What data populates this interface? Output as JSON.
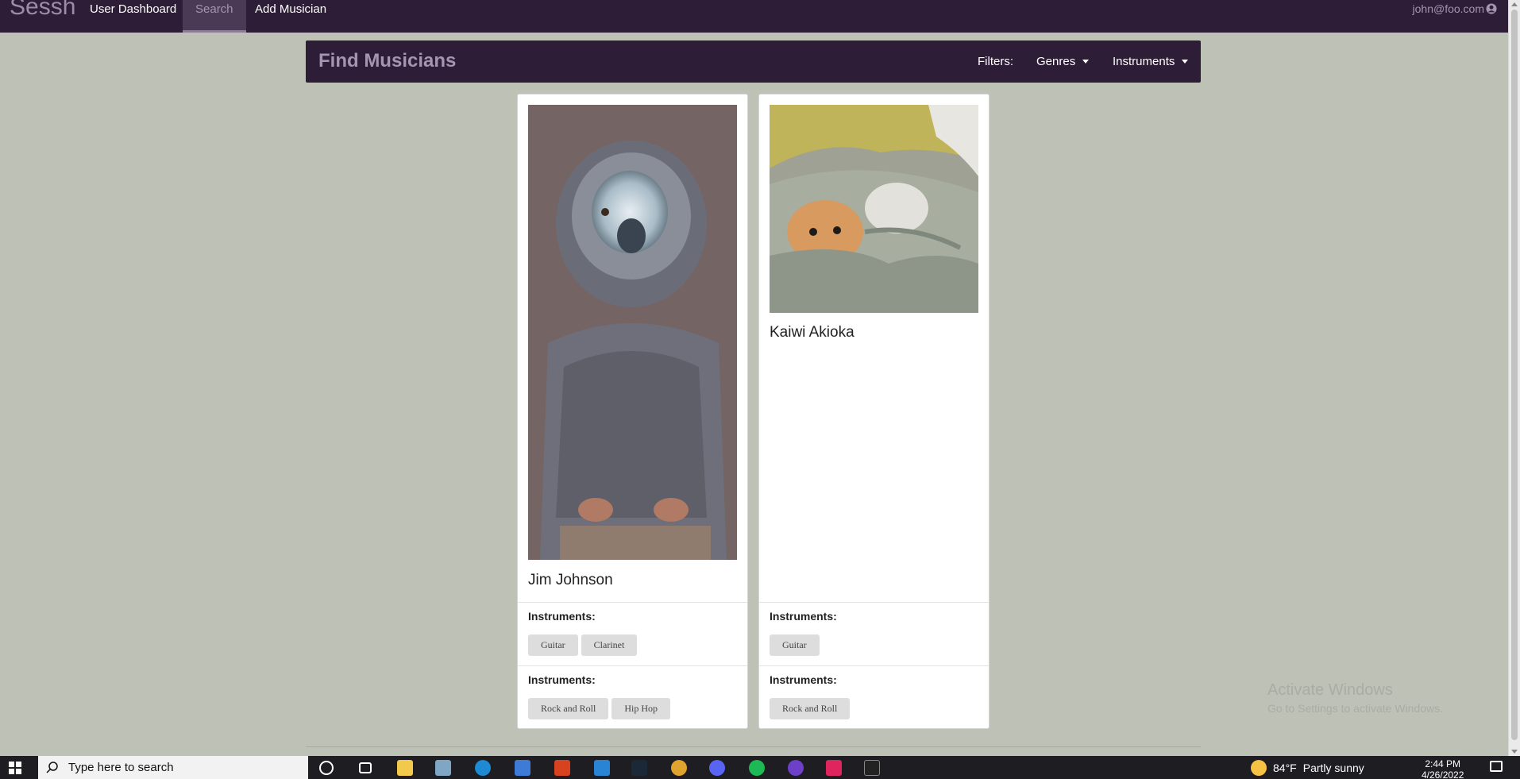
{
  "nav": {
    "brand": "Sessh",
    "links": [
      "User Dashboard",
      "Search",
      "Add Musician"
    ],
    "user": "john@foo.com"
  },
  "header": {
    "title": "Find Musicians",
    "filters_label": "Filters:",
    "genres": "Genres",
    "instruments": "Instruments"
  },
  "musicians": [
    {
      "name": "Jim Johnson",
      "instruments_label": "Instruments:",
      "instruments": [
        "Guitar",
        "Clarinet"
      ],
      "genres_label": "Instruments:",
      "genres": [
        "Rock and Roll",
        "Hip Hop"
      ]
    },
    {
      "name": "Kaiwi Akioka",
      "instruments_label": "Instruments:",
      "instruments": [
        "Guitar"
      ],
      "genres_label": "Instruments:",
      "genres": [
        "Rock and Roll"
      ]
    }
  ],
  "watermark": {
    "line1": "Activate Windows",
    "line2": "Go to Settings to activate Windows."
  },
  "taskbar": {
    "search_placeholder": "Type here to search",
    "temperature": "84°F",
    "weather": "Partly sunny",
    "time": "2:44 PM",
    "date": "4/26/2022"
  },
  "colors": {
    "nav_bg": "#2d1d36",
    "accent": "#a595b0",
    "page_bg": "#bec2b6"
  }
}
